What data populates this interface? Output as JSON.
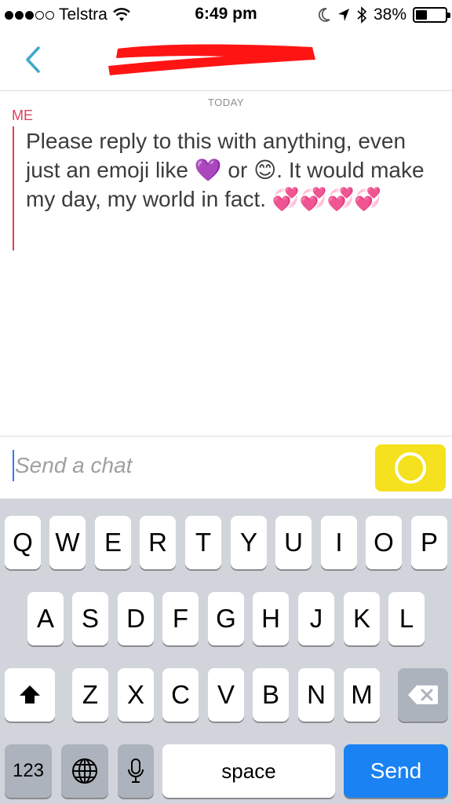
{
  "status_bar": {
    "carrier": "Telstra",
    "time": "6:49 pm",
    "battery_percent": "38%",
    "battery_level": 0.38,
    "icons": [
      "signal-dots-icon",
      "wifi-icon",
      "moon-icon",
      "location-arrow-icon",
      "bluetooth-icon",
      "battery-icon"
    ]
  },
  "nav": {
    "back_icon": "chevron-left-icon",
    "title_redacted": true,
    "accent_color": "#3ea9c9"
  },
  "conversation": {
    "date_label": "TODAY",
    "sender_label": "ME",
    "message_text": "Please reply to this with anything, even just an emoji like 💜 or 😊. It would make my day, my world in fact. 💞💞💞💞",
    "sender_color": "#e0405b"
  },
  "chat_input": {
    "placeholder": "Send a chat",
    "value": "",
    "capture_button_color": "#f5e11d",
    "capture_icon": "circle-icon"
  },
  "keyboard": {
    "row1": [
      "Q",
      "W",
      "E",
      "R",
      "T",
      "Y",
      "U",
      "I",
      "O",
      "P"
    ],
    "row2": [
      "A",
      "S",
      "D",
      "F",
      "G",
      "H",
      "J",
      "K",
      "L"
    ],
    "row3": [
      "Z",
      "X",
      "C",
      "V",
      "B",
      "N",
      "M"
    ],
    "shift_icon": "shift-arrow-icon",
    "delete_icon": "backspace-icon",
    "numbers_label": "123",
    "globe_icon": "globe-icon",
    "mic_icon": "microphone-icon",
    "space_label": "space",
    "send_label": "Send",
    "send_color": "#1a82f2"
  }
}
